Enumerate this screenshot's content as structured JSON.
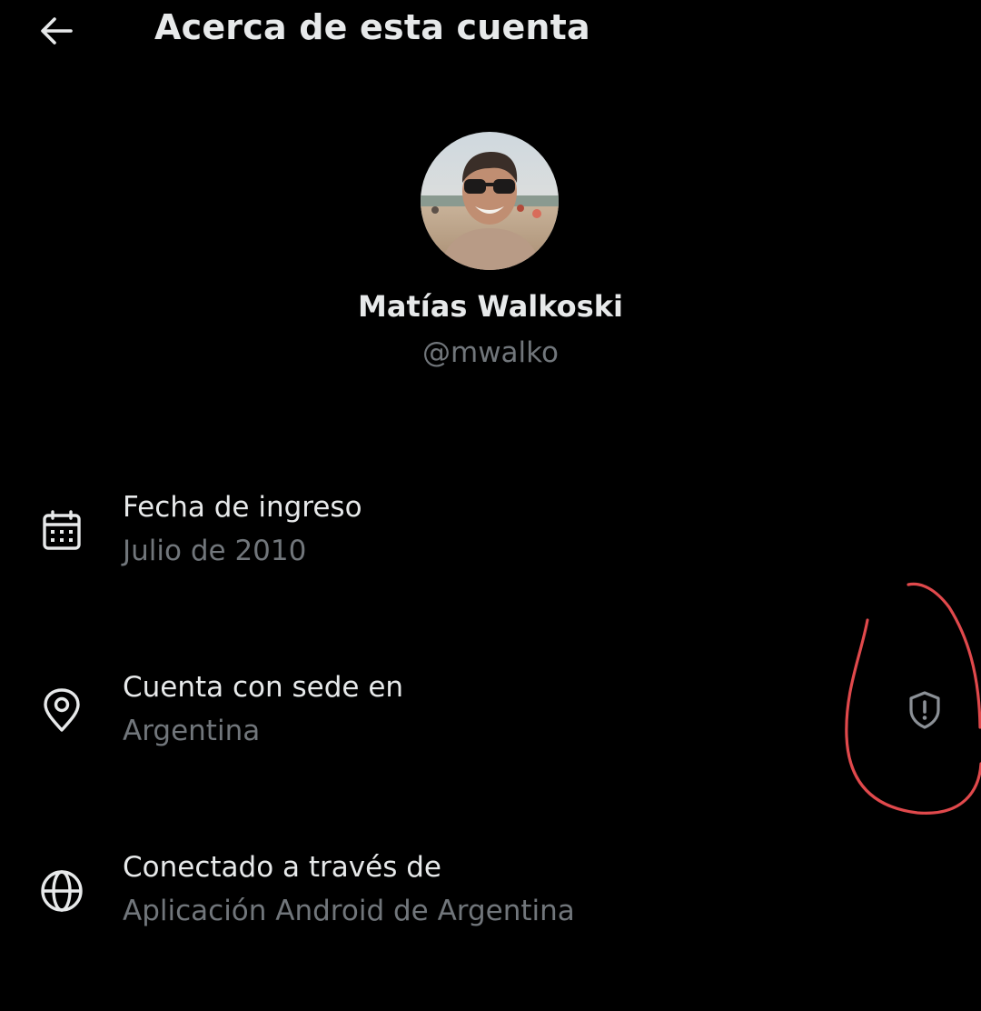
{
  "header": {
    "title": "Acerca de esta cuenta",
    "back_icon": "arrow-left-icon"
  },
  "profile": {
    "display_name": "Matías Walkoski",
    "handle": "@mwalko"
  },
  "rows": [
    {
      "icon": "calendar-icon",
      "label": "Fecha de ingreso",
      "value": "Julio de 2010"
    },
    {
      "icon": "location-pin-icon",
      "label": "Cuenta con sede en",
      "value": "Argentina",
      "trailing_icon": "shield-alert-icon"
    },
    {
      "icon": "globe-icon",
      "label": "Conectado a través de",
      "value": "Aplicación Android de Argentina"
    }
  ],
  "colors": {
    "background": "#000000",
    "primary_text": "#e7e9ea",
    "secondary_text": "#71767b",
    "annotation_stroke": "#e0494c"
  }
}
